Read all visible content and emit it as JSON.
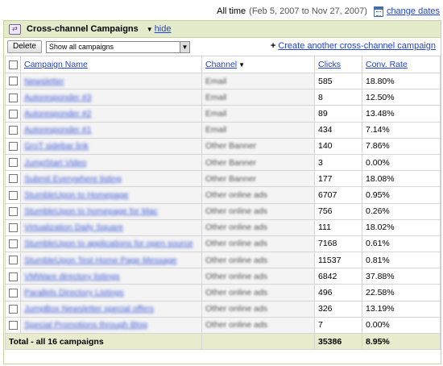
{
  "header": {
    "label": "All time",
    "range": "(Feb 5, 2007 to Nov 27, 2007)",
    "change_dates": "change dates"
  },
  "panel": {
    "title": "Cross-channel Campaigns",
    "hide_label": "hide"
  },
  "toolbar": {
    "delete_label": "Delete",
    "filter_value": "Show all campaigns",
    "create_label": "Create another cross-channel campaign"
  },
  "table": {
    "columns": [
      "Campaign Name",
      "Channel",
      "Clicks",
      "Conv. Rate"
    ],
    "rows": [
      {
        "name": "Newsletter",
        "channel": "Email",
        "clicks": "585",
        "rate": "18.80%"
      },
      {
        "name": "Autoresponder #3",
        "channel": "Email",
        "clicks": "8",
        "rate": "12.50%"
      },
      {
        "name": "Autoresponder #2",
        "channel": "Email",
        "clicks": "89",
        "rate": "13.48%"
      },
      {
        "name": "Autoresponder #1",
        "channel": "Email",
        "clicks": "434",
        "rate": "7.14%"
      },
      {
        "name": "GroT sidebar link",
        "channel": "Other Banner",
        "clicks": "140",
        "rate": "7.86%"
      },
      {
        "name": "JumpStart Video",
        "channel": "Other Banner",
        "clicks": "3",
        "rate": "0.00%"
      },
      {
        "name": "Submit Everywhere listing",
        "channel": "Other Banner",
        "clicks": "177",
        "rate": "18.08%"
      },
      {
        "name": "StumbleUpon to Homepage",
        "channel": "Other online ads",
        "clicks": "6707",
        "rate": "0.95%"
      },
      {
        "name": "StumbleUpon to homepage for Mac",
        "channel": "Other online ads",
        "clicks": "756",
        "rate": "0.26%"
      },
      {
        "name": "Virtualization Daily Square",
        "channel": "Other online ads",
        "clicks": "111",
        "rate": "18.02%"
      },
      {
        "name": "StumbleUpon to applications for open source",
        "channel": "Other online ads",
        "clicks": "7168",
        "rate": "0.61%"
      },
      {
        "name": "StumbleUpon Test Home Page Message",
        "channel": "Other online ads",
        "clicks": "11537",
        "rate": "0.81%"
      },
      {
        "name": "VMWare directory listings",
        "channel": "Other online ads",
        "clicks": "6842",
        "rate": "37.88%"
      },
      {
        "name": "Parallels Directory Listings",
        "channel": "Other online ads",
        "clicks": "496",
        "rate": "22.58%"
      },
      {
        "name": "JumpBox Newsletter special offers",
        "channel": "Other online ads",
        "clicks": "326",
        "rate": "13.19%"
      },
      {
        "name": "Special Promotions through Blog",
        "channel": "Other online ads",
        "clicks": "7",
        "rate": "0.00%"
      }
    ],
    "total": {
      "label": "Total - all 16 campaigns",
      "clicks": "35386",
      "rate": "8.95%"
    }
  }
}
